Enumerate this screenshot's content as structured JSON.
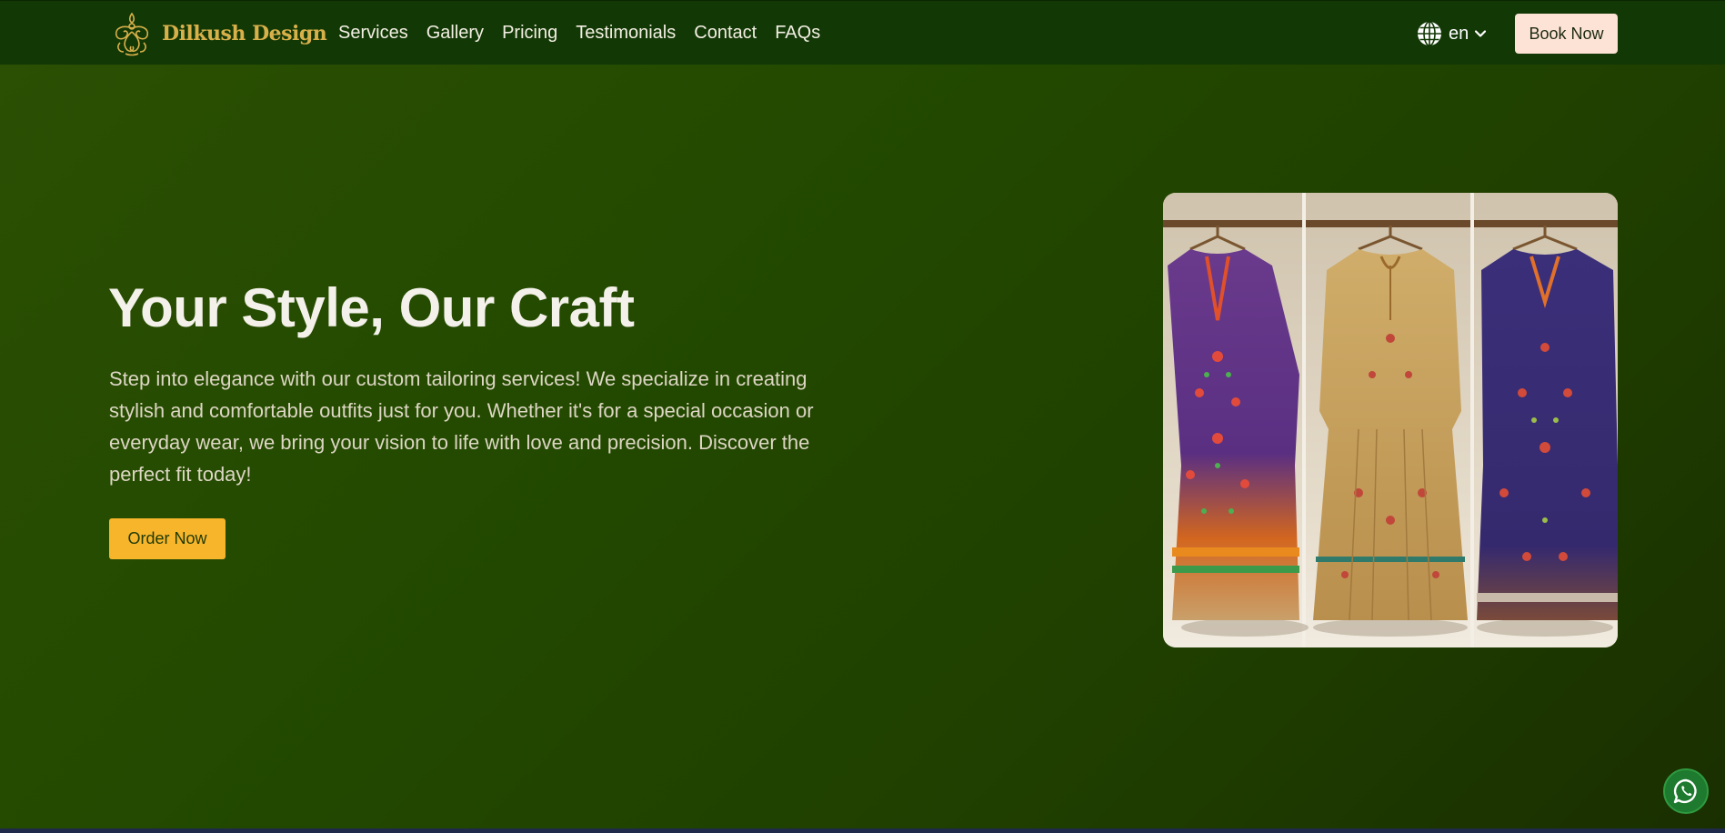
{
  "brand": {
    "name": "Dilkush Design",
    "logo": "ornamental-logo",
    "color": "#d8b04a"
  },
  "nav": {
    "links": [
      "Services",
      "Gallery",
      "Pricing",
      "Testimonials",
      "Contact",
      "FAQs"
    ],
    "language": {
      "icon": "globe-icon",
      "value": "en"
    },
    "book_label": "Book Now"
  },
  "hero": {
    "title": "Your Style, Our Craft",
    "description": "Step into elegance with our custom tailoring services! We specialize in creating stylish and comfortable outfits just for you. Whether it's for a special occasion or everyday wear, we bring your vision to life with love and precision. Discover the perfect fit today!",
    "cta_label": "Order Now",
    "image": "three embroidered dresses on hangers"
  },
  "floating": {
    "icon": "whatsapp-icon"
  },
  "colors": {
    "nav_bg": "#123806",
    "hero_bg": "#234a00",
    "cta": "#f7b52c",
    "book_bg": "#fde2d6"
  }
}
